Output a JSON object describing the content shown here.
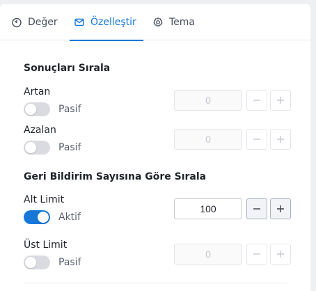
{
  "tabs": [
    {
      "label": "Değer",
      "icon": "timer-icon",
      "active": false
    },
    {
      "label": "Özelleştir",
      "icon": "mail-icon",
      "active": true
    },
    {
      "label": "Tema",
      "icon": "gear-icon",
      "active": false
    }
  ],
  "sort_section": {
    "title": "Sonuçları Sırala",
    "ascending": {
      "label": "Artan",
      "toggle_text": "Pasif",
      "enabled": false,
      "value": "0"
    },
    "descending": {
      "label": "Azalan",
      "toggle_text": "Pasif",
      "enabled": false,
      "value": "0"
    }
  },
  "feedback_section": {
    "title": "Geri Bildirim Sayısına Göre Sırala",
    "lower_limit": {
      "label": "Alt Limit",
      "toggle_text": "Aktif",
      "enabled": true,
      "value": "100"
    },
    "upper_limit": {
      "label": "Üst Limit",
      "toggle_text": "Pasif",
      "enabled": false,
      "value": "0"
    }
  },
  "colors": {
    "accent": "#1677d9",
    "toggle_off": "#d9dbe0"
  }
}
